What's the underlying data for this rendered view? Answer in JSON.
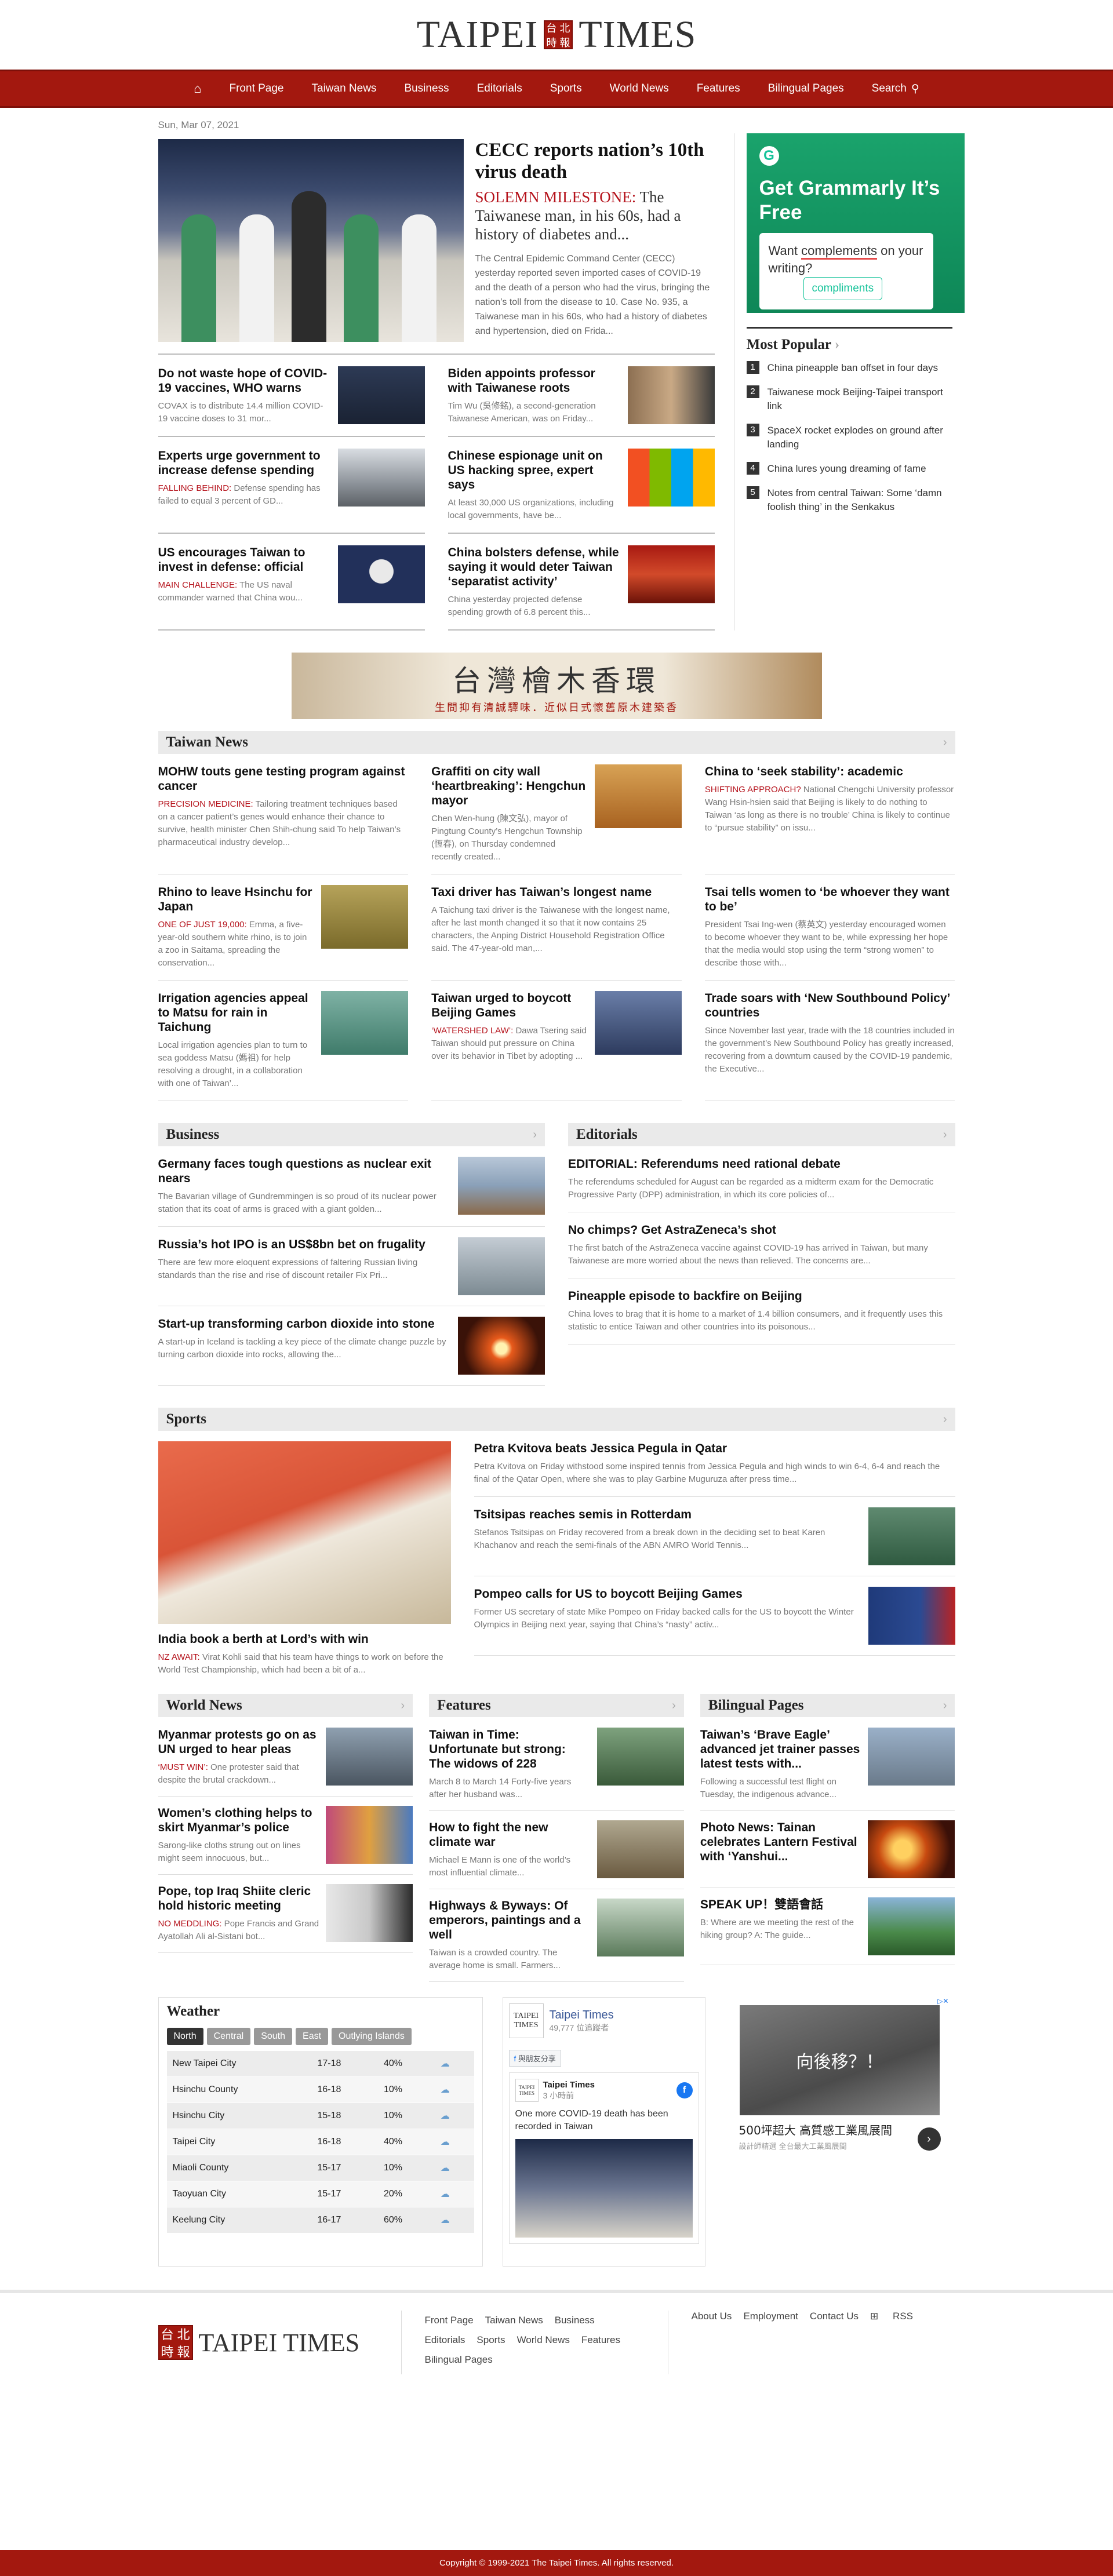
{
  "brand": {
    "name_left": "TAIPEI",
    "name_right": "TIMES",
    "seal": [
      "台",
      "北",
      "時",
      "報"
    ]
  },
  "nav": {
    "items": [
      "Front Page",
      "Taiwan News",
      "Business",
      "Editorials",
      "Sports",
      "World News",
      "Features",
      "Bilingual Pages",
      "Search"
    ]
  },
  "date": "Sun, Mar 07, 2021",
  "lead": {
    "title": "CECC reports nation’s 10th virus death",
    "kicker_label": "SOLEMN MILESTONE:",
    "kicker_text": " The Taiwanese man, in his 60s, had a history of diabetes and...",
    "summary": "The Central Epidemic Command Center (CECC) yesterday reported seven imported cases of COVID-19 and the death of a person who had the virus, bringing the nation’s toll from the disease to 10. Case No. 935, a Taiwanese man in his 60s, who had a history of diabetes and hypertension, died on Frida..."
  },
  "top_stories": [
    {
      "title": "Do not waste hope of COVID-19 vaccines, WHO warns",
      "label": "",
      "text": "COVAX is to distribute 14.4 million COVID-19 vaccine doses to 31 mor..."
    },
    {
      "title": "Biden appoints professor with Taiwanese roots",
      "label": "",
      "text": "Tim Wu (吳修銘), a second-generation Taiwanese American, was on Friday..."
    },
    {
      "title": "Experts urge government to increase defense spending",
      "label": "FALLING BEHIND:",
      "text": " Defense spending has failed to equal 3 percent of GD..."
    },
    {
      "title": "Chinese espionage unit on US hacking spree, expert says",
      "label": "",
      "text": "At least 30,000 US organizations, including local governments, have be..."
    },
    {
      "title": "US encourages Taiwan to invest in defense: official",
      "label": "MAIN CHALLENGE:",
      "text": " The US naval commander warned that China wou..."
    },
    {
      "title": "China bolsters defense, while saying it would deter Taiwan ‘separatist activity’",
      "label": "",
      "text": "China yesterday projected defense spending growth of 6.8 percent this..."
    }
  ],
  "ad_grammarly": {
    "badge": "G",
    "headline": "Get Grammarly It’s Free",
    "box_prefix": "Want ",
    "box_word": "complements",
    "box_suffix": " on your writing?",
    "suggestion": "compliments"
  },
  "popular": {
    "title": "Most Popular",
    "items": [
      "China pineapple ban offset in four days",
      "Taiwanese mock Beijing-Taipei transport link",
      "SpaceX rocket explodes on ground after landing",
      "China lures young dreaming of fame",
      "Notes from central Taiwan: Some ‘damn foolish thing’ in the Senkakus"
    ]
  },
  "banner_ad": {
    "title": "台灣檜木香環",
    "sub": "生間抑有清誠驛味．近似日式懷舊原木建築香"
  },
  "taiwan_news": {
    "title": "Taiwan News",
    "items": [
      {
        "title": "MOHW touts gene testing program against cancer",
        "label": "PRECISION MEDICINE:",
        "text": " Tailoring treatment techniques based on a cancer patient’s genes would enhance their chance to survive, health minister Chen Shih-chung said To help Taiwan’s pharmaceutical industry develop..."
      },
      {
        "title": "Graffiti on city wall ‘heartbreaking’: Hengchun mayor",
        "label": "",
        "text": "Chen Wen-hung (陳文弘), mayor of Pingtung County’s Hengchun Township (恆春), on Thursday condemned recently created..."
      },
      {
        "title": "China to ‘seek stability’: academic",
        "label": "SHIFTING APPROACH?",
        "text": " National Chengchi University professor Wang Hsin-hsien said that Beijing is likely to do nothing to Taiwan ‘as long as there is no trouble’ China is likely to continue to “pursue stability” on issu..."
      },
      {
        "title": "Rhino to leave Hsinchu for Japan",
        "label": "ONE OF JUST 19,000:",
        "text": " Emma, a five-year-old southern white rhino, is to join a zoo in Saitama, spreading the conservation..."
      },
      {
        "title": "Taxi driver has Taiwan’s longest name",
        "label": "",
        "text": "A Taichung taxi driver is the Taiwanese with the longest name, after he last month changed it so that it now contains 25 characters, the Anping District Household Registration Office said. The 47-year-old man,..."
      },
      {
        "title": "Tsai tells women to ‘be whoever they want to be’",
        "label": "",
        "text": "President Tsai Ing-wen (蔡英文) yesterday encouraged women to become whoever they want to be, while expressing her hope that the media would stop using the term “strong women” to describe those with..."
      },
      {
        "title": "Irrigation agencies appeal to Matsu for rain in Taichung",
        "label": "",
        "text": "Local irrigation agencies plan to turn to sea goddess Matsu (媽祖) for help resolving a drought, in a collaboration with one of Taiwan’..."
      },
      {
        "title": "Taiwan urged to boycott Beijing Games",
        "label": "‘WATERSHED LAW’:",
        "text": " Dawa Tsering said Taiwan should put pressure on China over its behavior in Tibet by adopting ..."
      },
      {
        "title": "Trade soars with ‘New Southbound Policy’ countries",
        "label": "",
        "text": "Since November last year, trade with the 18 countries included in the government’s New Southbound Policy has greatly increased, recovering from a downturn caused by the COVID-19 pandemic, the Executive..."
      }
    ]
  },
  "business": {
    "title": "Business",
    "items": [
      {
        "title": "Germany faces tough questions as nuclear exit nears",
        "text": "The Bavarian village of Gundremmingen is so proud of its nuclear power station that its coat of arms is graced with a giant golden..."
      },
      {
        "title": "Russia’s hot IPO is an US$8bn bet on frugality",
        "text": "There are few more eloquent expressions of faltering Russian living standards than the rise and rise of discount retailer Fix Pri..."
      },
      {
        "title": "Start-up transforming carbon dioxide into stone",
        "text": "A start-up in Iceland is tackling a key piece of the climate change puzzle by turning carbon dioxide into rocks, allowing the..."
      }
    ]
  },
  "editorials": {
    "title": "Editorials",
    "items": [
      {
        "title": "EDITORIAL: Referendums need rational debate",
        "text": "The referendums scheduled for August can be regarded as a midterm exam for the Democratic Progressive Party (DPP) administration, in which its core policies of..."
      },
      {
        "title": "No chimps? Get AstraZeneca’s shot",
        "text": "The first batch of the AstraZeneca vaccine against COVID-19 has arrived in Taiwan, but many Taiwanese are more worried about the news than relieved. The concerns are..."
      },
      {
        "title": "Pineapple episode to backfire on Beijing",
        "text": "China loves to brag that it is home to a market of 1.4 billion consumers, and it frequently uses this statistic to entice Taiwan and other countries into its poisonous..."
      }
    ]
  },
  "sports": {
    "title": "Sports",
    "lead": {
      "title": "India book a berth at Lord’s with win",
      "label": "NZ AWAIT:",
      "text": " Virat Kohli said that his team have things to work on before the World Test Championship, which had been a bit of a..."
    },
    "items": [
      {
        "title": "Petra Kvitova beats Jessica Pegula in Qatar",
        "text": "Petra Kvitova on Friday withstood some inspired tennis from Jessica Pegula and high winds to win 6-4, 6-4 and reach the final of the Qatar Open, where she was to play Garbine Muguruza after press time..."
      },
      {
        "title": "Tsitsipas reaches semis in Rotterdam",
        "text": "Stefanos Tsitsipas on Friday recovered from a break down in the deciding set to beat Karen Khachanov and reach the semi-finals of the ABN AMRO World Tennis..."
      },
      {
        "title": "Pompeo calls for US to boycott Beijing Games",
        "text": "Former US secretary of state Mike Pompeo on Friday backed calls for the US to boycott the Winter Olympics in Beijing next year, saying that China’s “nasty” activ..."
      }
    ]
  },
  "world_news": {
    "title": "World News",
    "items": [
      {
        "title": "Myanmar protests go on as UN urged to hear pleas",
        "label": "‘MUST WIN’:",
        "text": " One protester said that despite the brutal crackdown..."
      },
      {
        "title": "Women’s clothing helps to skirt Myanmar’s police",
        "label": "",
        "text": "Sarong-like cloths strung out on lines might seem innocuous, but..."
      },
      {
        "title": "Pope, top Iraq Shiite cleric hold historic meeting",
        "label": "NO MEDDLING:",
        "text": " Pope Francis and Grand Ayatollah Ali al-Sistani bot..."
      }
    ]
  },
  "features": {
    "title": "Features",
    "items": [
      {
        "title": "Taiwan in Time: Unfortunate but strong: The widows of 228",
        "text": "March 8 to March 14 Forty-five years after her husband was..."
      },
      {
        "title": "How to fight the new climate war",
        "text": "Michael E Mann is one of the world’s most influential climate..."
      },
      {
        "title": "Highways & Byways: Of emperors, paintings and a well",
        "text": "Taiwan is a crowded country. The average home is small. Farmers..."
      }
    ]
  },
  "bilingual": {
    "title": "Bilingual Pages",
    "items": [
      {
        "title": "Taiwan’s ‘Brave Eagle’ advanced jet trainer passes latest tests with...",
        "text": "Following a successful test flight on Tuesday, the indigenous advance..."
      },
      {
        "title": "Photo News: Tainan celebrates Lantern Festival with ‘Yanshui...",
        "text": ""
      },
      {
        "title": "SPEAK UP！雙語會話",
        "text": "B: Where are we meeting the rest of the hiking group? A: The guide..."
      }
    ]
  },
  "weather": {
    "title": "Weather",
    "tabs": [
      "North",
      "Central",
      "South",
      "East",
      "Outlying Islands"
    ],
    "rows": [
      {
        "city": "New Taipei City",
        "temp": "17-18",
        "rain": "40%"
      },
      {
        "city": "Hsinchu County",
        "temp": "16-18",
        "rain": "10%"
      },
      {
        "city": "Hsinchu City",
        "temp": "15-18",
        "rain": "10%"
      },
      {
        "city": "Taipei City",
        "temp": "16-18",
        "rain": "40%"
      },
      {
        "city": "Miaoli County",
        "temp": "15-17",
        "rain": "10%"
      },
      {
        "city": "Taoyuan City",
        "temp": "15-17",
        "rain": "20%"
      },
      {
        "city": "Keelung City",
        "temp": "16-17",
        "rain": "60%"
      }
    ]
  },
  "facebook": {
    "page": "Taipei Times",
    "followers": "49,777 位追蹤者",
    "share": "與朋友分享",
    "post_page": "Taipei Times",
    "post_time": "3 小時前",
    "post_text": "One more COVID-19 death has been recorded in Taiwan",
    "logo_text": "TAIPEI TIMES"
  },
  "ad_furniture": {
    "overlay": "向後移？！",
    "caption": "500坪超大 高質感工業風展間",
    "sub": "設計師精選 全台最大工業風展間"
  },
  "footer": {
    "links_a": [
      "Front Page",
      "Taiwan News",
      "Business",
      "Editorials",
      "Sports",
      "World News",
      "Features",
      "Bilingual Pages"
    ],
    "links_b": [
      "About Us",
      "Employment",
      "Contact Us",
      "RSS"
    ],
    "copyright": "Copyright © 1999-2021 The Taipei Times. All rights reserved."
  },
  "colors": {
    "brand_red": "#a3180f",
    "accent_red": "#b5121b",
    "grammarly_green": "#15c39a"
  }
}
